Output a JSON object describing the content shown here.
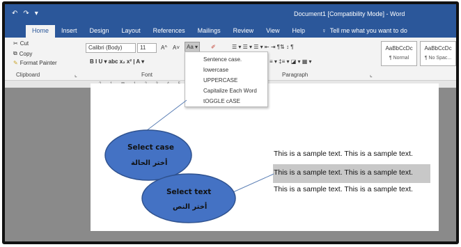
{
  "title_bar": {
    "quick_access": [
      "↶",
      "↷",
      "▾"
    ],
    "title": "Document1 [Compatibility Mode]  -  Word"
  },
  "tabs": [
    "Home",
    "Insert",
    "Design",
    "Layout",
    "References",
    "Mailings",
    "Review",
    "View",
    "Help"
  ],
  "tell_me": "Tell me what you want to do",
  "clipboard": {
    "cut": "Cut",
    "copy": "Copy",
    "format_painter": "Format Painter",
    "label": "Clipboard"
  },
  "font": {
    "family": "Calibri (Body)",
    "size": "11",
    "grow": "A^",
    "shrink": "A˅",
    "change_case": "Aa ▾",
    "row2": "B  I  U  ▾ abc  x₂  x²  |  A ▾",
    "label": "Font"
  },
  "paragraph": {
    "row1": "☰ ▾  ☰ ▾  ☰ ▾   ⇤  ⇥   ¶⇅  ↕  ¶",
    "row2": "≡ ▾   ‡≡ ▾   ◪ ▾  ▦ ▾",
    "label": "Paragraph"
  },
  "styles": [
    {
      "preview": "AaBbCcDc",
      "name": "¶ Normal"
    },
    {
      "preview": "AaBbCcDc",
      "name": "¶ No Spac..."
    }
  ],
  "change_case_menu": [
    "Sentence case.",
    "lowercase",
    "UPPERCASE",
    "Capitalize Each Word",
    "tOGGLE cASE"
  ],
  "ruler": "2 · · · 1 · · · ⊠ · · · 1 · · · 2 · · · 3 · · · 4 · · · 5 · · · 6 · · · 7 · · · 8 · · · 9 · · · 10 · · 11 · · 12 ·",
  "document": {
    "lines": [
      "This is a sample text. This is a sample text.",
      "This is a sample text. This is a sample text.",
      "This is a sample text. This is a sample text."
    ]
  },
  "callouts": [
    {
      "en": "Select case",
      "ar": "أختر الحالة"
    },
    {
      "en": "Select text",
      "ar": "أختر النص"
    }
  ],
  "colors": {
    "word_blue": "#2b579a",
    "ellipse_fill": "#4472c4",
    "selection": "#c8c8c8"
  }
}
